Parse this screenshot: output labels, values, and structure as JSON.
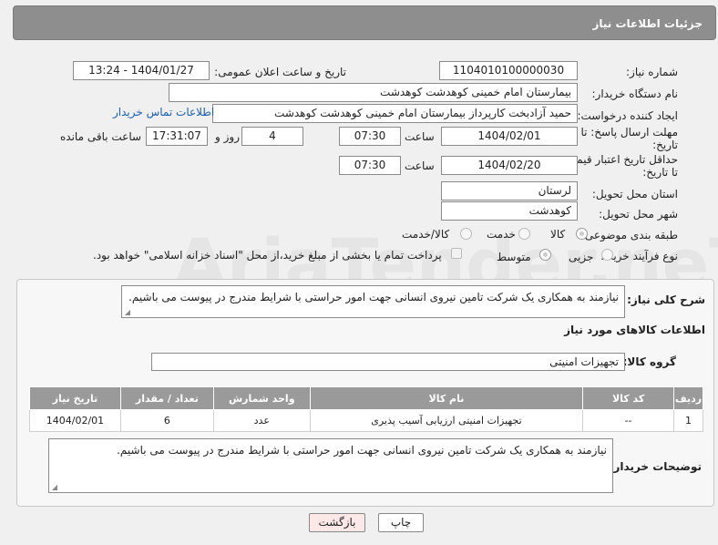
{
  "header": {
    "title": "جزئیات اطلاعات نیاز"
  },
  "form": {
    "need_number_label": "شماره نیاز:",
    "need_number": "1104010100000030",
    "announce_label": "تاریخ و ساعت اعلان عمومی:",
    "announce_value": "1404/01/27 - 13:24",
    "buyer_org_label": "نام دستگاه خریدار:",
    "buyer_org": "بیمارستان امام خمینی کوهدشت کوهدشت",
    "creator_label": "ایجاد کننده درخواست:",
    "creator": "حمید آزادبخت کارپرداز بیمارستان امام خمینی کوهدشت کوهدشت",
    "contact_link": "اطلاعات تماس خریدار",
    "deadline_label_1": "مهلت ارسال پاسخ: تا",
    "deadline_label_2": "تاریخ:",
    "deadline_date": "1404/02/01",
    "time_label": "ساعت",
    "deadline_time": "07:30",
    "days_value": "4",
    "days_label": "روز و",
    "remaining_time": "17:31:07",
    "remaining_label": "ساعت باقی مانده",
    "validity_label_1": "حداقل تاریخ اعتبار قیمت:",
    "validity_label_2": "تا تاریخ:",
    "validity_date": "1404/02/20",
    "validity_time": "07:30",
    "province_label": "استان محل تحویل:",
    "province": "لرستان",
    "city_label": "شهر محل تحویل:",
    "city": "کوهدشت",
    "category_label": "طبقه بندی موضوعی:",
    "category_options": [
      "کالا",
      "خدمت",
      "کالا/خدمت"
    ],
    "process_label": "نوع فرآیند خرید :",
    "process_options": [
      "جزیی",
      "متوسط"
    ],
    "payment_note": "پرداخت تمام یا بخشی از مبلغ خرید،از محل \"اسناد خزانه اسلامی\" خواهد بود."
  },
  "details": {
    "summary_label": "شرح کلی نیاز:",
    "summary": "نیازمند به همکاری یک شرکت تامین نیروی انسانی جهت امور حراستی با شرایط مندرج در پیوست می باشیم.",
    "goods_info_title": "اطلاعات کالاهای مورد نیاز",
    "goods_group_label": "گروه کالا:",
    "goods_group": "تجهیزات امنیتی",
    "table_headers": [
      "ردیف",
      "کد کالا",
      "نام کالا",
      "واحد شمارش",
      "تعداد / مقدار",
      "تاریخ نیاز"
    ],
    "table_rows": [
      [
        "1",
        "--",
        "تجهیزات امنیتی ارزیابی آسیب پذیری",
        "عدد",
        "6",
        "1404/02/01"
      ]
    ],
    "buyer_notes_label": "توضیحات خریدار:",
    "buyer_notes": "نیازمند به همکاری یک شرکت تامین نیروی انسانی جهت امور حراستی با شرایط مندرج در پیوست می باشیم."
  },
  "buttons": {
    "print": "چاپ",
    "back": "بازگشت"
  },
  "watermark": "AriaTender.neT",
  "colors": {
    "header_bg": "#8e8e8e",
    "table_header_bg": "#9a9a9a",
    "link": "#1a5fb4",
    "back_button_bg": "#fde8e8"
  }
}
